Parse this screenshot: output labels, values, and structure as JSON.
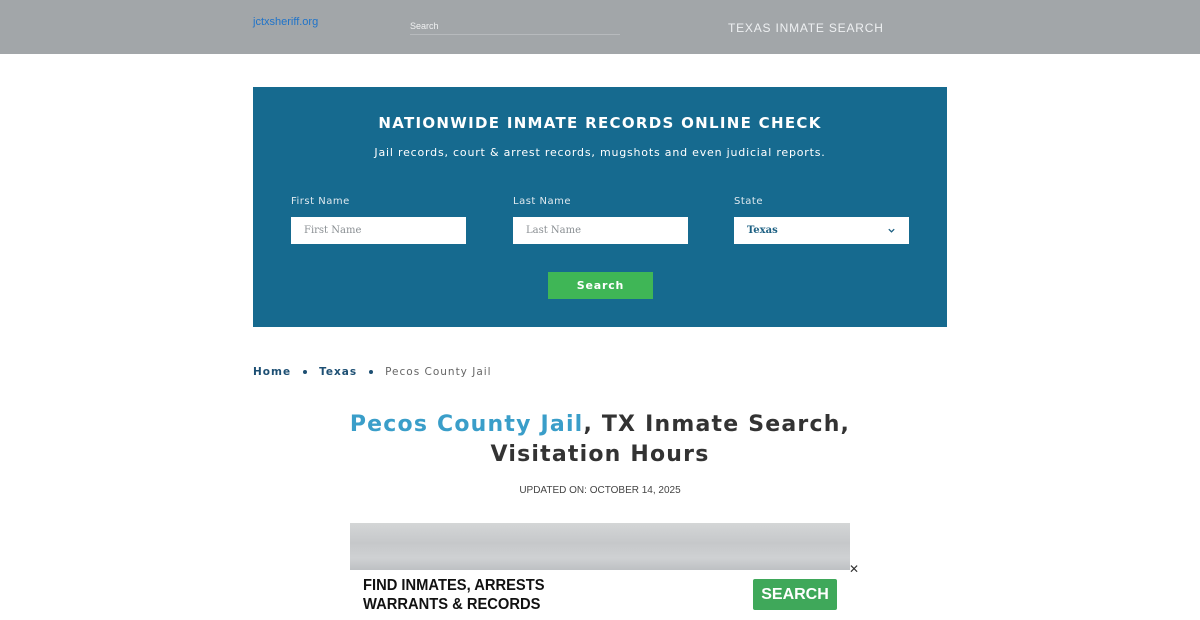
{
  "header": {
    "site_name": "jctxsheriff.org",
    "search_placeholder": "Search",
    "nav_title": "TEXAS INMATE SEARCH"
  },
  "hero": {
    "title": "NATIONWIDE INMATE RECORDS ONLINE CHECK",
    "subtitle": "Jail records, court & arrest records, mugshots and even judicial reports.",
    "first_name_label": "First Name",
    "first_name_placeholder": "First Name",
    "last_name_label": "Last Name",
    "last_name_placeholder": "Last Name",
    "state_label": "State",
    "state_value": "Texas",
    "search_button": "Search"
  },
  "breadcrumb": {
    "items": [
      "Home",
      "Texas"
    ],
    "current": "Pecos County Jail"
  },
  "page": {
    "title_link": "Pecos County Jail",
    "title_rest_line1": ", TX Inmate Search,",
    "title_line2": "Visitation Hours",
    "updated": "UPDATED ON: OCTOBER 14, 2025"
  },
  "ad": {
    "line1": "FIND INMATES, ARRESTS",
    "line2": "WARRANTS & RECORDS",
    "button": "SEARCH",
    "close": "✕"
  },
  "colors": {
    "header_bg": "#a2a6a9",
    "hero_bg": "#166a8f",
    "accent_green": "#3fb656",
    "title_link": "#3a9ec9",
    "crumb": "#1d4f73"
  }
}
